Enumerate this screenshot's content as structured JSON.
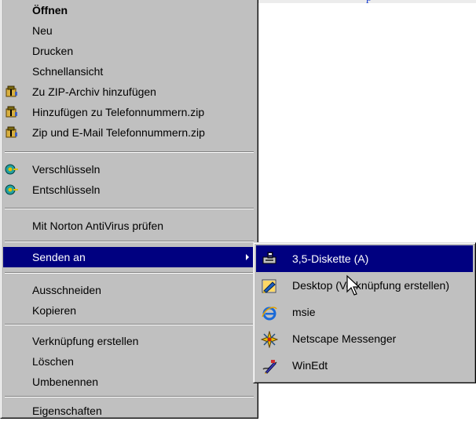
{
  "header": {
    "fragment": "p"
  },
  "context_menu": {
    "items": [
      {
        "label": "Öffnen"
      },
      {
        "label": "Neu"
      },
      {
        "label": "Drucken"
      },
      {
        "label": "Schnellansicht"
      },
      {
        "label": "Zu ZIP-Archiv hinzufügen",
        "icon": "winzip-icon"
      },
      {
        "label": "Hinzufügen zu Telefonnummern.zip",
        "icon": "winzip-icon"
      },
      {
        "label": "Zip und E-Mail Telefonnummern.zip",
        "icon": "winzip-icon"
      },
      {
        "label": "Verschlüsseln",
        "icon": "encryption-key-icon"
      },
      {
        "label": "Entschlüsseln",
        "icon": "encryption-key-icon"
      },
      {
        "label": "Mit Norton AntiVirus prüfen"
      },
      {
        "label": "Senden an",
        "has_submenu": true,
        "highlighted": true
      },
      {
        "label": "Ausschneiden"
      },
      {
        "label": "Kopieren"
      },
      {
        "label": "Verknüpfung erstellen"
      },
      {
        "label": "Löschen"
      },
      {
        "label": "Umbenennen"
      },
      {
        "label": "Eigenschaften"
      }
    ]
  },
  "send_to_submenu": {
    "items": [
      {
        "label": "3,5-Diskette (A)",
        "icon": "floppy-drive-icon",
        "highlighted": true
      },
      {
        "label": "Desktop (Verknüpfung erstellen)",
        "icon": "desktop-shortcut-icon"
      },
      {
        "label": "msie",
        "icon": "internet-explorer-icon"
      },
      {
        "label": "Netscape Messenger",
        "icon": "netscape-messenger-icon"
      },
      {
        "label": "WinEdt",
        "icon": "winedt-icon"
      }
    ]
  },
  "colors": {
    "menu_bg": "#c0c0c0",
    "highlight_bg": "#000080",
    "highlight_text": "#ffffff"
  }
}
